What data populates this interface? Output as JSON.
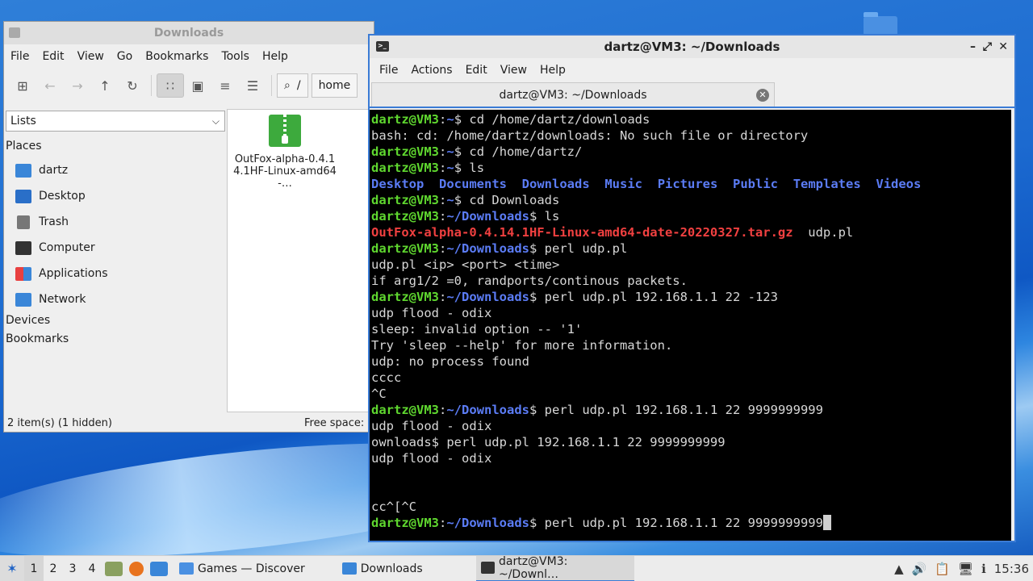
{
  "file_manager": {
    "title": "Downloads",
    "menu": [
      "File",
      "Edit",
      "View",
      "Go",
      "Bookmarks",
      "Tools",
      "Help"
    ],
    "path_buttons": [
      "/",
      "home"
    ],
    "side_pane_selector": "Lists",
    "places_header": "Places",
    "places": [
      {
        "label": "dartz",
        "icon": "home-folder-icon",
        "color": "#3a86d8"
      },
      {
        "label": "Desktop",
        "icon": "desktop-icon",
        "color": "#2a6fc8"
      },
      {
        "label": "Trash",
        "icon": "trash-icon",
        "color": "#777777"
      },
      {
        "label": "Computer",
        "icon": "computer-icon",
        "color": "#333333"
      },
      {
        "label": "Applications",
        "icon": "applications-icon",
        "color": "#e8a020"
      },
      {
        "label": "Network",
        "icon": "network-folder-icon",
        "color": "#3a86d8"
      }
    ],
    "devices_header": "Devices",
    "bookmarks_header": "Bookmarks",
    "files": [
      {
        "name": "OutFox-alpha-0.4.14.1HF-Linux-amd64-…",
        "icon": "archive-icon"
      }
    ],
    "status_left": "2 item(s) (1 hidden)",
    "status_right": "Free space:"
  },
  "terminal": {
    "title": "dartz@VM3: ~/Downloads",
    "menu": [
      "File",
      "Actions",
      "Edit",
      "View",
      "Help"
    ],
    "tab_label": "dartz@VM3: ~/Downloads",
    "colors": {
      "user": "#5fd72f",
      "path": "#5b7cf5",
      "directory": "#5b7cf5",
      "archive": "#f04040",
      "text": "#d7d7d7",
      "background": "#000000"
    },
    "lines": [
      {
        "type": "prompt",
        "user": "dartz@VM3",
        "path": "~",
        "cmd": " cd /home/dartz/downloads"
      },
      {
        "type": "out",
        "text": "bash: cd: /home/dartz/downloads: No such file or directory"
      },
      {
        "type": "prompt",
        "user": "dartz@VM3",
        "path": "~",
        "cmd": " cd /home/dartz/"
      },
      {
        "type": "prompt",
        "user": "dartz@VM3",
        "path": "~",
        "cmd": " ls"
      },
      {
        "type": "ls",
        "items": [
          {
            "text": "Desktop",
            "kind": "dir"
          },
          {
            "text": "Documents",
            "kind": "dir"
          },
          {
            "text": "Downloads",
            "kind": "dir"
          },
          {
            "text": "Music",
            "kind": "dir"
          },
          {
            "text": "Pictures",
            "kind": "dir"
          },
          {
            "text": "Public",
            "kind": "dir"
          },
          {
            "text": "Templates",
            "kind": "dir"
          },
          {
            "text": "Videos",
            "kind": "dir"
          }
        ]
      },
      {
        "type": "prompt",
        "user": "dartz@VM3",
        "path": "~",
        "cmd": " cd Downloads"
      },
      {
        "type": "prompt",
        "user": "dartz@VM3",
        "path": "~/Downloads",
        "cmd": " ls"
      },
      {
        "type": "ls",
        "items": [
          {
            "text": "OutFox-alpha-0.4.14.1HF-Linux-amd64-date-20220327.tar.gz",
            "kind": "archive"
          },
          {
            "text": "udp.pl",
            "kind": "file"
          }
        ]
      },
      {
        "type": "prompt",
        "user": "dartz@VM3",
        "path": "~/Downloads",
        "cmd": " perl udp.pl"
      },
      {
        "type": "out",
        "text": "udp.pl <ip> <port> <time>"
      },
      {
        "type": "out",
        "text": "if arg1/2 =0, randports/continous packets."
      },
      {
        "type": "prompt",
        "user": "dartz@VM3",
        "path": "~/Downloads",
        "cmd": " perl udp.pl 192.168.1.1 22 -123"
      },
      {
        "type": "out",
        "text": "udp flood - odix"
      },
      {
        "type": "out",
        "text": "sleep: invalid option -- '1'"
      },
      {
        "type": "out",
        "text": "Try 'sleep --help' for more information."
      },
      {
        "type": "out",
        "text": "udp: no process found"
      },
      {
        "type": "out",
        "text": "cccc"
      },
      {
        "type": "out",
        "text": "^C"
      },
      {
        "type": "prompt",
        "user": "dartz@VM3",
        "path": "~/Downloads",
        "cmd": " perl udp.pl 192.168.1.1 22 9999999999"
      },
      {
        "type": "out",
        "text": "udp flood - odix"
      },
      {
        "type": "out",
        "text": "ownloads$ perl udp.pl 192.168.1.1 22 9999999999"
      },
      {
        "type": "out",
        "text": "udp flood - odix"
      },
      {
        "type": "out",
        "text": ""
      },
      {
        "type": "out",
        "text": ""
      },
      {
        "type": "out",
        "text": "cc^[^C"
      },
      {
        "type": "prompt",
        "user": "dartz@VM3",
        "path": "~/Downloads",
        "cmd": " perl udp.pl 192.168.1.1 22 9999999999",
        "cursor": true
      }
    ]
  },
  "taskbar": {
    "workspaces": [
      "1",
      "2",
      "3",
      "4"
    ],
    "active_workspace": "1",
    "tasks": [
      {
        "label": "Games — Discover",
        "icon": "discover-icon",
        "active": false
      },
      {
        "label": "Downloads",
        "icon": "folder-icon",
        "active": false
      },
      {
        "label": "dartz@VM3: ~/Downl…",
        "icon": "terminal-icon",
        "active": true
      }
    ],
    "clock": "15:36"
  }
}
